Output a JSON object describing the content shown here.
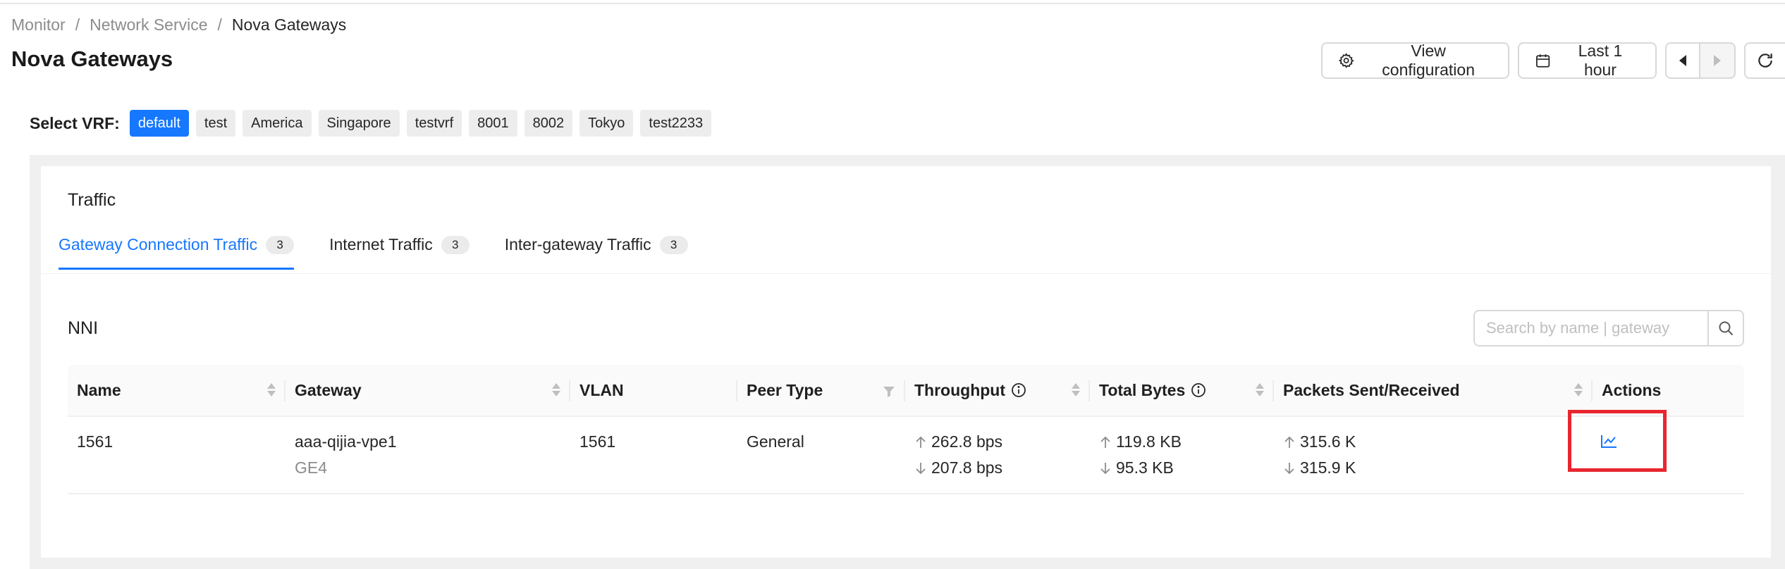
{
  "breadcrumb": [
    {
      "label": "Monitor"
    },
    {
      "label": "Network Service"
    },
    {
      "label": "Nova Gateways"
    }
  ],
  "breadcrumb_sep": "/",
  "page_title": "Nova Gateways",
  "header": {
    "view_config_label": "View configuration",
    "time_range_label": "Last 1 hour"
  },
  "vrf": {
    "label": "Select VRF:",
    "options": [
      "default",
      "test",
      "America",
      "Singapore",
      "testvrf",
      "8001",
      "8002",
      "Tokyo",
      "test2233"
    ],
    "selected": "default"
  },
  "card_title": "Traffic",
  "tabs": [
    {
      "label": "Gateway Connection Traffic",
      "count": "3",
      "active": true
    },
    {
      "label": "Internet Traffic",
      "count": "3",
      "active": false
    },
    {
      "label": "Inter-gateway Traffic",
      "count": "3",
      "active": false
    }
  ],
  "section_title": "NNI",
  "search": {
    "placeholder": "Search by name | gateway",
    "value": ""
  },
  "table": {
    "columns": [
      "Name",
      "Gateway",
      "VLAN",
      "Peer Type",
      "Throughput",
      "Total Bytes",
      "Packets Sent/Received",
      "Actions"
    ],
    "rows": [
      {
        "name": "1561",
        "gateway": "aaa-qijia-vpe1",
        "gateway_sub": "GE4",
        "vlan": "1561",
        "peer_type": "General",
        "throughput_up": "262.8 bps",
        "throughput_down": "207.8 bps",
        "bytes_up": "119.8 KB",
        "bytes_down": "95.3 KB",
        "packets_up": "315.6 K",
        "packets_down": "315.9 K"
      }
    ]
  },
  "colors": {
    "accent": "#1677ff",
    "highlight_box": "#e8262f",
    "chip_bg": "#ededed"
  },
  "icons": {
    "view_config": "gear-icon",
    "time_range": "calendar-icon",
    "prev": "caret-left-icon",
    "next": "caret-right-icon",
    "refresh": "refresh-icon",
    "search": "search-icon",
    "action": "line-chart-icon"
  }
}
